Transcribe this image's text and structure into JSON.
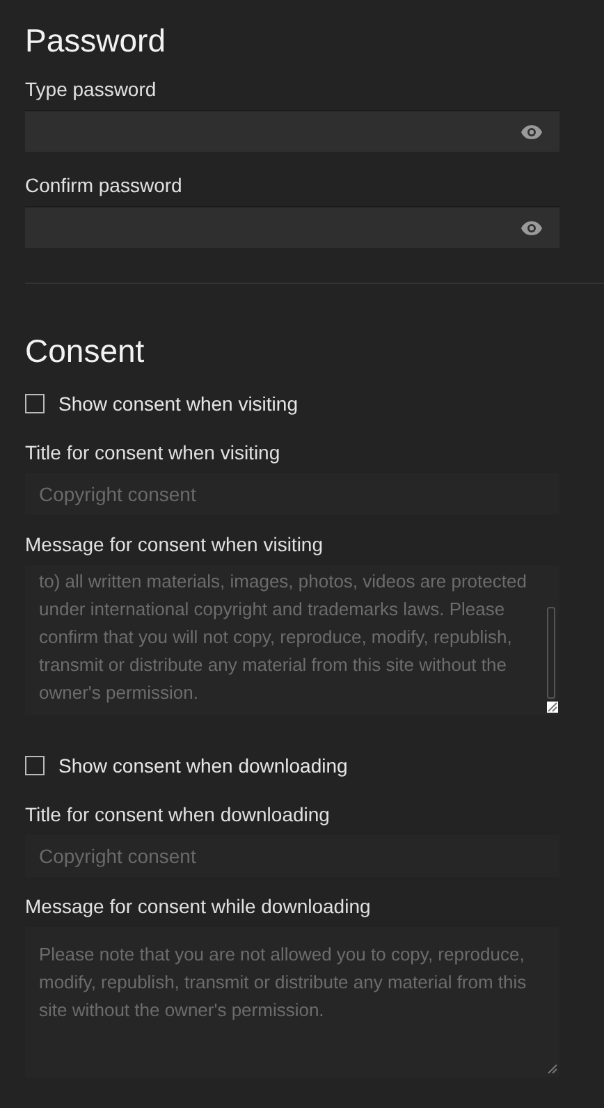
{
  "password": {
    "title": "Password",
    "fields": [
      {
        "label": "Type password"
      },
      {
        "label": "Confirm password"
      }
    ]
  },
  "consent": {
    "title": "Consent",
    "groups": [
      {
        "checkbox": {
          "label": "Show consent when visiting",
          "checked": false
        },
        "title_label": "Title for consent when visiting",
        "title_placeholder": "Copyright consent",
        "message_label": "Message for consent when visiting",
        "message": "to) all written materials, images, photos, videos are protected under international copyright and trademarks laws. Please confirm that you will not copy, reproduce, modify, republish, transmit or distribute any material from this site without the owner's permission.",
        "scrolled": true
      },
      {
        "checkbox": {
          "label": "Show consent when downloading",
          "checked": false
        },
        "title_label": "Title for consent when downloading",
        "title_placeholder": "Copyright consent",
        "message_label": "Message for consent while downloading",
        "message": "Please note that you are not allowed you to copy, reproduce, modify, republish, transmit or distribute any material from this site without the owner's permission.",
        "scrolled": false
      }
    ]
  }
}
